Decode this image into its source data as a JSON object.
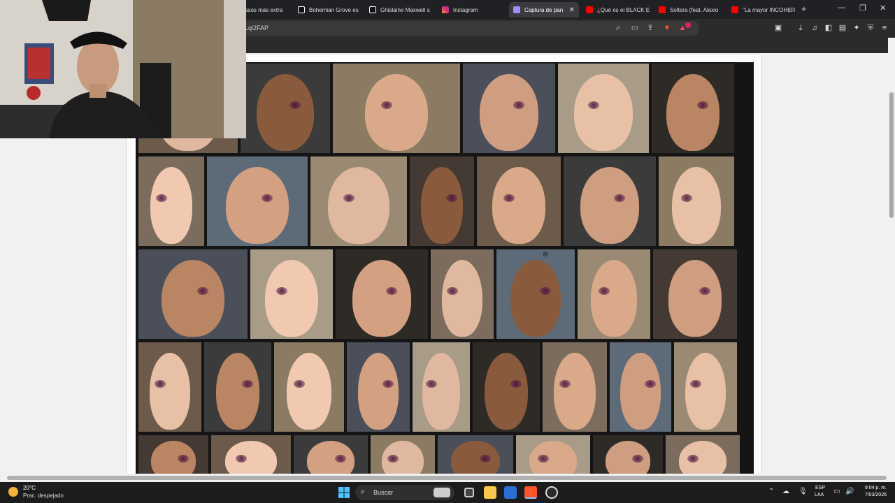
{
  "browser": {
    "tabs": [
      {
        "label": "casos más extra",
        "icon": "tiktok-icon",
        "color": "#ffffff"
      },
      {
        "label": "Bohemian Grove es",
        "icon": "tiktok-icon",
        "color": "#ffffff"
      },
      {
        "label": "Ghislaine Maxwell s",
        "icon": "tiktok-icon",
        "color": "#ffffff"
      },
      {
        "label": "Instagram",
        "icon": "instagram-icon",
        "color": "#e1306c"
      },
      {
        "label": "Captura de pan",
        "icon": "capture-icon",
        "color": "#a78bfa",
        "active": true
      },
      {
        "label": "¿Qué es el BLACK E",
        "icon": "youtube-icon",
        "color": "#ff0000"
      },
      {
        "label": "Soltera (feat. Alexio",
        "icon": "youtube-icon",
        "color": "#ff0000"
      },
      {
        "label": "\"La mayor INCOHER",
        "icon": "youtube-icon",
        "color": "#ff0000"
      }
    ],
    "new_tab_symbol": "+",
    "close_tab_symbol": "✕",
    "url": "Lql2FAP",
    "brave_badge": "8",
    "rewards_badge": "1"
  },
  "taskbar": {
    "temperature": "20°C",
    "weather": "Prac. despejado",
    "search_placeholder": "Buscar",
    "language": "ESP",
    "layout": "LAA",
    "time": "9:04 p. m.",
    "date": "7/03/2026"
  },
  "collage": {
    "rows": 5,
    "photo_count": 40,
    "colors": {
      "frame": "#151515",
      "skin": "#d9a98a",
      "bruise": "#6b2a55"
    }
  }
}
